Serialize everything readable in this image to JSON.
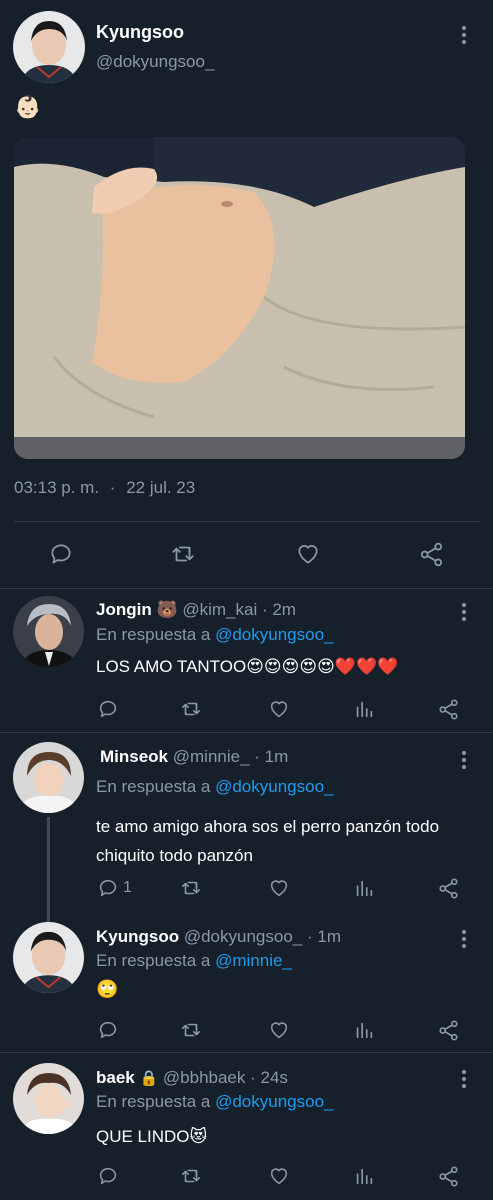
{
  "main_tweet": {
    "author_name": "Kyungsoo",
    "author_handle": "@dokyungsoo_",
    "text": "👶🏻",
    "timestamp": "03:13 p. m.",
    "dot": "·",
    "date": "22 jul. 23"
  },
  "replies": [
    {
      "author_name": "Jongin 🐻",
      "author_handle": "@kim_kai",
      "time": "· 2m",
      "reply_prefix": "En respuesta a",
      "reply_to": "@dokyungsoo_",
      "text": "LOS AMO TANTOO😍😍😍😍😍❤️❤️❤️"
    },
    {
      "author_name": "Minseok",
      "author_handle": "@minnie_",
      "time": "· 1m",
      "reply_prefix": "En respuesta a",
      "reply_to": "@dokyungsoo_",
      "text_line1": "te amo amigo ahora sos el perro panzón todo",
      "text_line2": "chiquito todo panzón",
      "reply_count": "1"
    },
    {
      "author_name": "Kyungsoo",
      "author_handle": "@dokyungsoo_",
      "time": "· 1m",
      "reply_prefix": "En respuesta a",
      "reply_to": "@minnie_",
      "text": "🙄"
    },
    {
      "author_name": "baek",
      "lock": "🔒",
      "author_handle": "@bbhbaek",
      "time": "· 24s",
      "reply_prefix": "En respuesta a",
      "reply_to": "@dokyungsoo_",
      "text": "QUE LINDO😻"
    }
  ],
  "icons": {
    "reply": "reply-icon",
    "retweet": "retweet-icon",
    "like": "heart-icon",
    "views": "views-icon",
    "share": "share-icon",
    "more": "more-icon"
  },
  "colors": {
    "background": "#15202b",
    "link": "#1d9bf0",
    "muted": "#8b98a5",
    "divider": "#2f3b47"
  }
}
